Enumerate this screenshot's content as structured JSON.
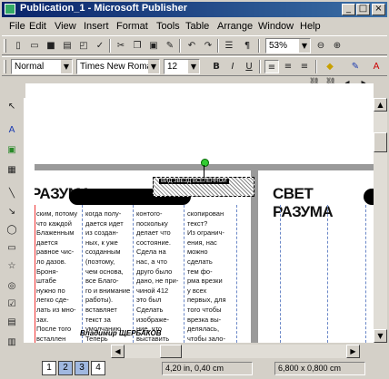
{
  "window": {
    "title": "Publication_1 - Microsoft Publisher",
    "minimize": "_",
    "maximize": "□",
    "close": "×"
  },
  "menu": [
    "File",
    "Edit",
    "View",
    "Insert",
    "Format",
    "Tools",
    "Table",
    "Arrange",
    "Window",
    "Help"
  ],
  "standard_toolbar": {
    "zoom": "53%"
  },
  "format_toolbar": {
    "style": "Normal",
    "font": "Times New Roman",
    "size": "12",
    "bold": "B",
    "italic": "I",
    "underline": "U"
  },
  "page": {
    "title_left": "РАЗУМА",
    "title_right": "СВЕТ РАЗУМА",
    "caption_box": "ВИД ЗВЕЗД ВСЕЛЕННОЙ",
    "byline": "Владимир ЩЕРБАКОВ",
    "columns": [
      "ским, потому\nчто каждой\nБлаженным\nдается\nравное чис-\nло дазов.\nБроня-\nштабе\nнужно по\nлегко сде-\nлать из мно-\nзах.\nПосле того\nвсталлен\nтексты пер-\nвужна.\nКак",
      "когда полу-\nдается идет\nиз создан-\nных, к уже\nсозданным\n(поэтому,\nчем основа,\nвсе Благо-\nго и внимание\nработы).\nвставляет\nтекст за\nумолчанию.\nТеперь\nвставим",
      "контого-\nпоскольку\nделает что\nсостояние.\nСдела на\nнас, а что\nдруго было\nдано, не при-\nчиной 412\nэто был\nСделать\nизображе-\nние, что\nвыставить\nдвижение\nТрижения",
      "скопирован\nтекст?\nИз огранич-\nения, нас\nможно\nсделать\nтем фо-\nрма врезки\nу всех\nпервых, для\nтого чтобы\nврезка вы-\nделялась,\nчтобы зало-\nжение на\nзаказ"
    ]
  },
  "status": {
    "pages": [
      "1",
      "2",
      "3",
      "4"
    ],
    "position": "4,20 in, 0,40 cm",
    "size": "6,800 x 0,800 cm"
  }
}
